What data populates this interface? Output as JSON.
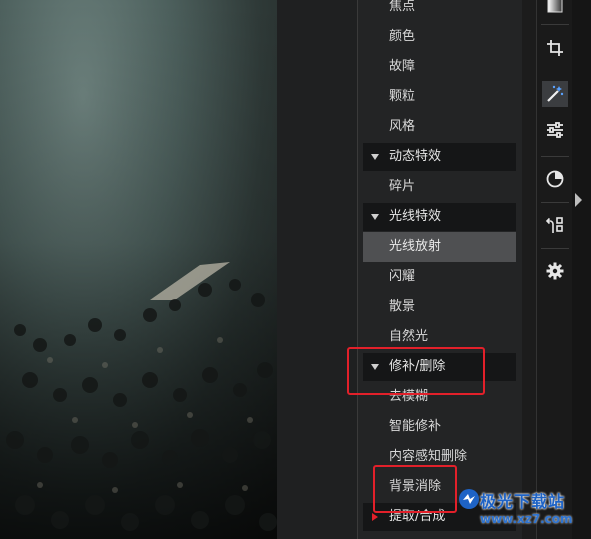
{
  "effects_panel": {
    "groups": [
      {
        "header": null,
        "items": [
          "焦点",
          "颜色",
          "故障",
          "颗粒",
          "风格"
        ]
      },
      {
        "header": "动态特效",
        "items": [
          "碎片"
        ]
      },
      {
        "header": "光线特效",
        "items": [
          "光线放射",
          "闪耀",
          "散景",
          "自然光"
        ],
        "selected_item": "光线放射"
      },
      {
        "header": "修补/删除",
        "items": [
          "去模糊",
          "智能修补",
          "内容感知删除",
          "背景消除"
        ]
      },
      {
        "header": "提取/合成",
        "items": []
      }
    ],
    "highlighted": [
      "修补/删除",
      "背景消除"
    ]
  },
  "toolbar": {
    "tools": [
      "gradient-icon",
      "crop-icon",
      "magic-wand-icon",
      "adjust-sliders-icon",
      "color-circle-icon",
      "transform-icon",
      "settings-gear-icon"
    ],
    "active_tool": "magic-wand-icon"
  },
  "watermark": {
    "title": "极光下载站",
    "url": "www.xz7.com"
  },
  "colors": {
    "highlight_box": "#e2202a",
    "panel_bg": "#232425",
    "header_bg": "#151617",
    "selected_bg": "#4f5052"
  }
}
